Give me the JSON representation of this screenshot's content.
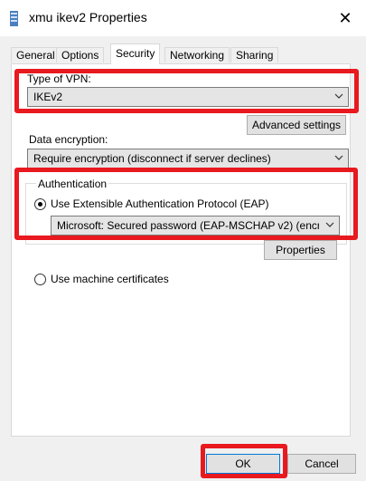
{
  "window": {
    "title": "xmu ikev2 Properties",
    "close_glyph": "✕"
  },
  "tabs": [
    {
      "label": "General",
      "active": false
    },
    {
      "label": "Options",
      "active": false
    },
    {
      "label": "Security",
      "active": true
    },
    {
      "label": "Networking",
      "active": false
    },
    {
      "label": "Sharing",
      "active": false
    }
  ],
  "security": {
    "vpn_type_label": "Type of VPN:",
    "vpn_type_value": "IKEv2",
    "advanced_button": "Advanced settings",
    "encryption_label": "Data encryption:",
    "encryption_value": "Require encryption (disconnect if server declines)",
    "auth_group_label": "Authentication",
    "eap_radio_label": "Use Extensible Authentication Protocol (EAP)",
    "eap_method_value": "Microsoft: Secured password (EAP-MSCHAP v2) (encryp",
    "properties_button": "Properties",
    "machine_cert_label": "Use machine certificates"
  },
  "footer": {
    "ok_label": "OK",
    "cancel_label": "Cancel"
  },
  "colors": {
    "highlight": "#e8191f",
    "accent": "#0078d7"
  }
}
